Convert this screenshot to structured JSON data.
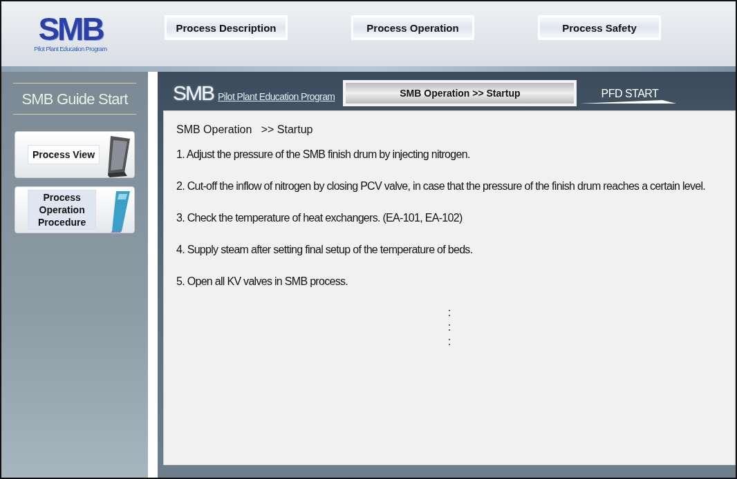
{
  "header": {
    "logo": "SMB",
    "logo_subtitle": "Pilot Plant Education Program",
    "nav": [
      {
        "label": "Process Description"
      },
      {
        "label": "Process Operation"
      },
      {
        "label": "Process Safety"
      }
    ]
  },
  "sidebar": {
    "title": "SMB Guide Start",
    "buttons": [
      {
        "label": "Process View",
        "kind": "monitor"
      },
      {
        "label": "Process\nOperation\nProcedure",
        "kind": "book"
      }
    ]
  },
  "main": {
    "logo": "SMB",
    "logo_subtitle": "Pilot Plant Education Program",
    "breadcrumb": "SMB Operation >> Startup",
    "pfd_link": "PFD START",
    "content_title": "SMB Operation   >> Startup",
    "steps": [
      "1.  Adjust the pressure of the SMB finish drum by injecting nitrogen.",
      "2. Cut-off the inflow of nitrogen by closing PCV valve, in case that the pressure of the finish drum reaches a certain level.",
      "3. Check the temperature of heat exchangers. (EA-101, EA-102)",
      "4. Supply steam after setting final setup of the temperature of beds.",
      "5. Open all KV valves in SMB process."
    ],
    "continuation": [
      ":",
      ":",
      ":"
    ]
  }
}
